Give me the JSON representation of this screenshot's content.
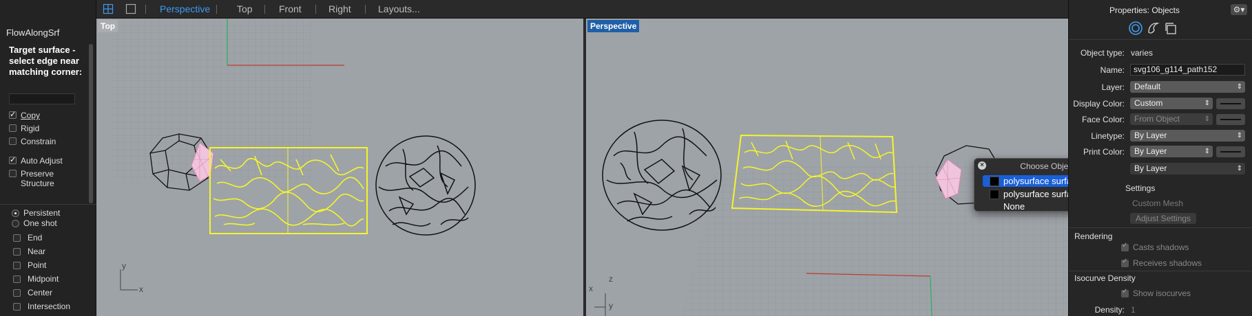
{
  "command": {
    "title": "FlowAlongSrf",
    "prompt": "Target surface - select edge near matching corner:",
    "options": [
      {
        "label": "Copy",
        "checked": true
      },
      {
        "label": "Rigid",
        "checked": false
      },
      {
        "label": "Constrain",
        "checked": false
      },
      {
        "label": "Auto Adjust",
        "checked": true
      },
      {
        "label": "Preserve Structure",
        "checked": false
      }
    ]
  },
  "osnap": {
    "modes": [
      {
        "label": "Persistent",
        "selected": true
      },
      {
        "label": "One shot",
        "selected": false
      }
    ],
    "snaps": [
      "End",
      "Near",
      "Point",
      "Midpoint",
      "Center",
      "Intersection"
    ]
  },
  "toolbar": {
    "tabs": [
      "Perspective",
      "Top",
      "Front",
      "Right",
      "Layouts..."
    ],
    "active_tab": "Perspective",
    "accent": "#3e9bf0"
  },
  "viewports": {
    "top": {
      "label": "Top",
      "axis_x": "x",
      "axis_y": "y"
    },
    "perspective": {
      "label": "Perspective",
      "axis_x": "x",
      "axis_y": "y",
      "axis_z": "z"
    }
  },
  "popup": {
    "title": "Choose Objects",
    "items": [
      {
        "label": "polysurface surface",
        "selected": true,
        "swatch": "#000000"
      },
      {
        "label": "polysurface surface",
        "selected": false,
        "swatch": "#000000"
      },
      {
        "label": "None",
        "selected": false,
        "swatch": null
      }
    ]
  },
  "properties": {
    "title": "Properties: Objects",
    "gear_icon": "gear-icon",
    "object_type_label": "Object type:",
    "object_type_value": "varies",
    "name_label": "Name:",
    "name_value": "svg106_g114_path152",
    "layer_label": "Layer:",
    "layer_value": "Default",
    "display_color_label": "Display Color:",
    "display_color_value": "Custom",
    "face_color_label": "Face Color:",
    "face_color_value": "From Object",
    "linetype_label": "Linetype:",
    "linetype_value": "By Layer",
    "print_color_label": "Print Color:",
    "print_color_value": "By Layer",
    "print_width_value": "By Layer",
    "settings_section": "Settings",
    "custom_mesh": "Custom Mesh",
    "adjust_settings": "Adjust Settings",
    "rendering_section": "Rendering",
    "casts_shadows": "Casts shadows",
    "receives_shadows": "Receives shadows",
    "isocurve_section": "Isocurve Density",
    "show_isocurves": "Show isocurves",
    "density_label": "Density:",
    "density_value": "1"
  }
}
